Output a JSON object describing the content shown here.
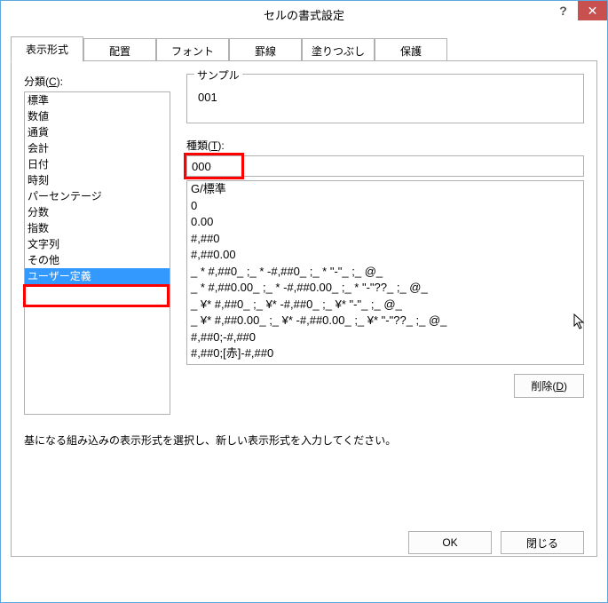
{
  "titlebar": {
    "title": "セルの書式設定",
    "help": "?",
    "close": "✕"
  },
  "tabs": [
    "表示形式",
    "配置",
    "フォント",
    "罫線",
    "塗りつぶし",
    "保護"
  ],
  "activeTabIndex": 0,
  "category": {
    "label_prefix": "分類(",
    "label_u": "C",
    "label_suffix": "):",
    "items": [
      "標準",
      "数値",
      "通貨",
      "会計",
      "日付",
      "時刻",
      "パーセンテージ",
      "分数",
      "指数",
      "文字列",
      "その他",
      "ユーザー定義"
    ],
    "selectedIndex": 11
  },
  "sample": {
    "legend": "サンプル",
    "value": "001"
  },
  "type": {
    "label_prefix": "種類(",
    "label_u": "T",
    "label_suffix": "):",
    "value": "000"
  },
  "formats": [
    "G/標準",
    "0",
    "0.00",
    "#,##0",
    "#,##0.00",
    "_ * #,##0_ ;_ * -#,##0_ ;_ * \"-\"_ ;_ @_ ",
    "_ * #,##0.00_ ;_ * -#,##0.00_ ;_ * \"-\"??_ ;_ @_ ",
    "_ ¥* #,##0_ ;_ ¥* -#,##0_ ;_ ¥* \"-\"_ ;_ @_ ",
    "_ ¥* #,##0.00_ ;_ ¥* -#,##0.00_ ;_ ¥* \"-\"??_ ;_ @_ ",
    "#,##0;-#,##0",
    "#,##0;[赤]-#,##0"
  ],
  "delete": {
    "label_prefix": "削除(",
    "label_u": "D",
    "label_suffix": ")"
  },
  "description": "基になる組み込みの表示形式を選択し、新しい表示形式を入力してください。",
  "buttons": {
    "ok": "OK",
    "close": "閉じる"
  }
}
